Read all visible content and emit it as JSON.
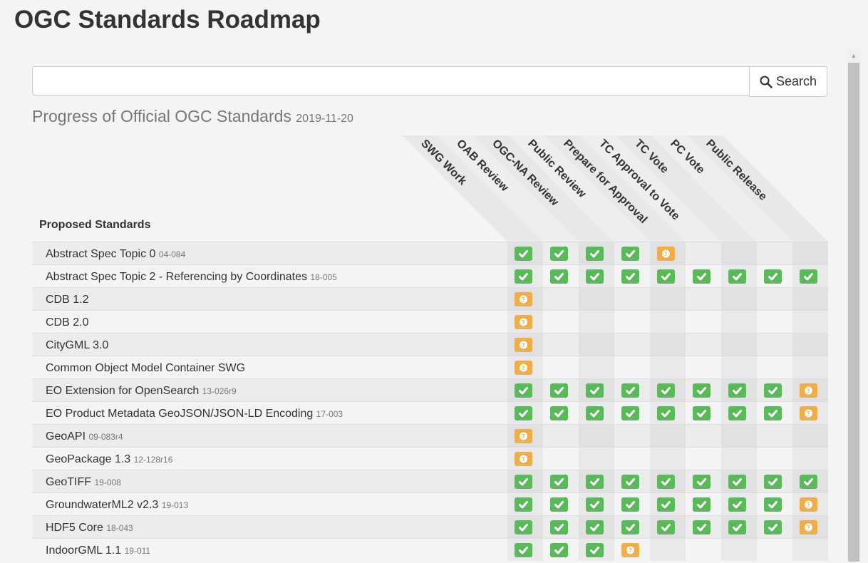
{
  "page": {
    "title": "OGC Standards Roadmap"
  },
  "search": {
    "placeholder": "",
    "value": "",
    "button_label": "Search",
    "icon": "search-icon"
  },
  "section": {
    "title": "Progress of Official OGC Standards",
    "date": "2019-11-20"
  },
  "table": {
    "row_header": "Proposed Standards",
    "stages": [
      "SWG Work",
      "OAB Review",
      "OGC-NA Review",
      "Public Review",
      "Prepare for Approval",
      "TC Approval to Vote",
      "TC Vote",
      "PC Vote",
      "Public Release"
    ],
    "status_legend": {
      "done": "check-icon",
      "pending": "question-icon"
    },
    "colors": {
      "done": "#5cb85c",
      "pending": "#f0ad4e"
    },
    "rows": [
      {
        "name": "Abstract Spec Topic 0",
        "id": "04-084",
        "status": [
          "done",
          "done",
          "done",
          "done",
          "pending",
          "",
          "",
          "",
          ""
        ]
      },
      {
        "name": "Abstract Spec Topic 2 - Referencing by Coordinates",
        "id": "18-005",
        "status": [
          "done",
          "done",
          "done",
          "done",
          "done",
          "done",
          "done",
          "done",
          "done"
        ]
      },
      {
        "name": "CDB 1.2",
        "id": "",
        "status": [
          "pending",
          "",
          "",
          "",
          "",
          "",
          "",
          "",
          ""
        ]
      },
      {
        "name": "CDB 2.0",
        "id": "",
        "status": [
          "pending",
          "",
          "",
          "",
          "",
          "",
          "",
          "",
          ""
        ]
      },
      {
        "name": "CityGML 3.0",
        "id": "",
        "status": [
          "pending",
          "",
          "",
          "",
          "",
          "",
          "",
          "",
          ""
        ]
      },
      {
        "name": "Common Object Model Container SWG",
        "id": "",
        "status": [
          "pending",
          "",
          "",
          "",
          "",
          "",
          "",
          "",
          ""
        ]
      },
      {
        "name": "EO Extension for OpenSearch",
        "id": "13-026r9",
        "status": [
          "done",
          "done",
          "done",
          "done",
          "done",
          "done",
          "done",
          "done",
          "pending"
        ]
      },
      {
        "name": "EO Product Metadata GeoJSON/JSON-LD Encoding",
        "id": "17-003",
        "status": [
          "done",
          "done",
          "done",
          "done",
          "done",
          "done",
          "done",
          "done",
          "pending"
        ]
      },
      {
        "name": "GeoAPI",
        "id": "09-083r4",
        "status": [
          "pending",
          "",
          "",
          "",
          "",
          "",
          "",
          "",
          ""
        ]
      },
      {
        "name": "GeoPackage 1.3",
        "id": "12-128r16",
        "status": [
          "pending",
          "",
          "",
          "",
          "",
          "",
          "",
          "",
          ""
        ]
      },
      {
        "name": "GeoTIFF",
        "id": "19-008",
        "status": [
          "done",
          "done",
          "done",
          "done",
          "done",
          "done",
          "done",
          "done",
          "done"
        ]
      },
      {
        "name": "GroundwaterML2 v2.3",
        "id": "19-013",
        "status": [
          "done",
          "done",
          "done",
          "done",
          "done",
          "done",
          "done",
          "done",
          "pending"
        ]
      },
      {
        "name": "HDF5 Core",
        "id": "18-043",
        "status": [
          "done",
          "done",
          "done",
          "done",
          "done",
          "done",
          "done",
          "done",
          "pending"
        ]
      },
      {
        "name": "IndoorGML 1.1",
        "id": "19-011",
        "status": [
          "done",
          "done",
          "done",
          "pending",
          "",
          "",
          "",
          "",
          ""
        ]
      }
    ]
  }
}
